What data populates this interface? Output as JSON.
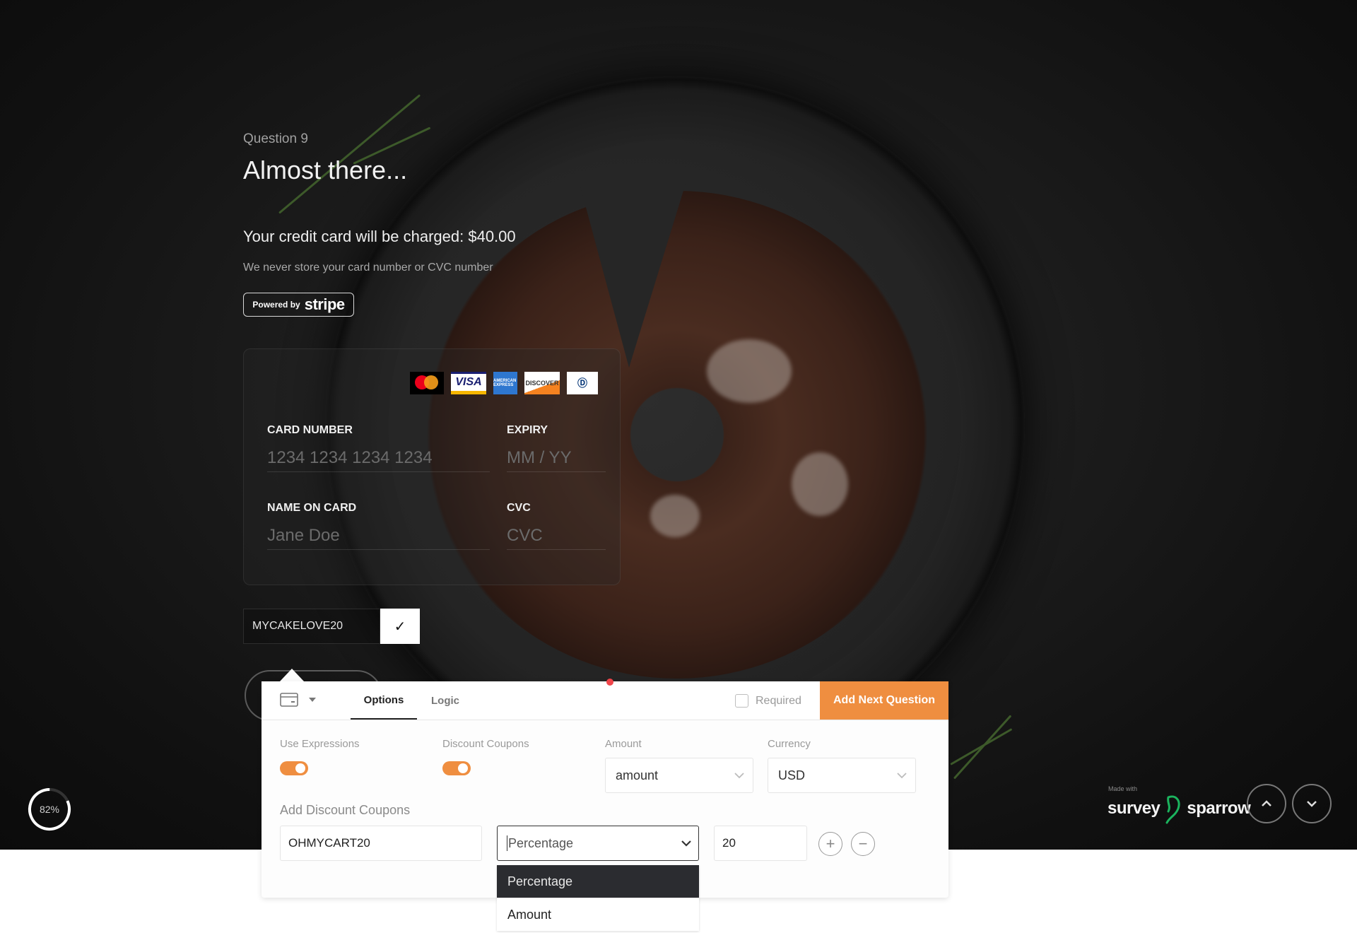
{
  "question": {
    "number_label": "Question 9",
    "title": "Almost there...",
    "charge_text": "Your credit card will be charged: $40.00",
    "security_note": "We never store your card number or CVC number",
    "stripe_badge": {
      "powered_by": "Powered by",
      "brand": "stripe"
    }
  },
  "card_form": {
    "brands": [
      "mastercard",
      "visa",
      "amex",
      "discover",
      "diners-club"
    ],
    "brand_labels": {
      "visa": "VISA",
      "amex": "AMERICAN EXPRESS",
      "discover": "DISCOVER",
      "diners": "Diners Club"
    },
    "fields": {
      "card_number": {
        "label": "CARD NUMBER",
        "placeholder": "1234 1234 1234 1234"
      },
      "expiry": {
        "label": "EXPIRY",
        "placeholder": "MM / YY"
      },
      "name_on_card": {
        "label": "NAME ON CARD",
        "placeholder": "Jane Doe"
      },
      "cvc": {
        "label": "CVC",
        "placeholder": "CVC"
      }
    }
  },
  "coupon": {
    "value": "MYCAKELOVE20",
    "apply_icon": "check-icon",
    "apply_glyph": "✓"
  },
  "progress": {
    "percent": 82,
    "label": "82%"
  },
  "branding": {
    "made_with": "Made with",
    "left": "survey",
    "right": "sparrow"
  },
  "navigation": {
    "up_glyph": "⌃",
    "down_glyph": "⌄"
  },
  "editor": {
    "question_type_icon": "credit-card-icon",
    "tabs": [
      {
        "label": "Options",
        "active": true
      },
      {
        "label": "Logic",
        "active": false,
        "has_notification": true
      }
    ],
    "required": {
      "label": "Required",
      "checked": false
    },
    "add_next_label": "Add Next Question",
    "accent_color": "#ef8e40",
    "options": {
      "use_expressions": {
        "label": "Use Expressions",
        "on": true
      },
      "discount_coupons": {
        "label": "Discount Coupons",
        "on": true
      },
      "amount": {
        "label": "Amount",
        "value": "amount"
      },
      "currency": {
        "label": "Currency",
        "value": "USD"
      }
    },
    "add_discount": {
      "label": "Add Discount Coupons",
      "code": "OHMYCART20",
      "type": "Percentage",
      "type_options": [
        "Percentage",
        "Amount"
      ],
      "value": "20",
      "add_glyph": "+",
      "remove_glyph": "−"
    }
  }
}
